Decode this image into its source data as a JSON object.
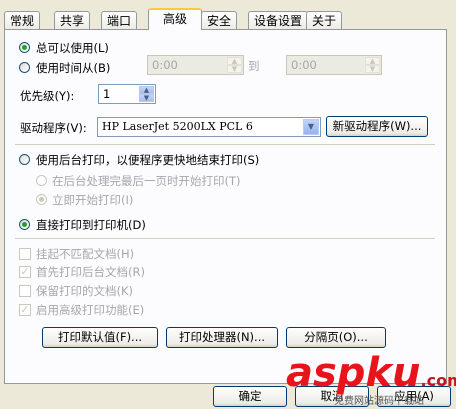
{
  "tabs": [
    "常规",
    "共享",
    "端口",
    "高级",
    "安全",
    "设备设置",
    "关于"
  ],
  "availability": {
    "always_label": "总可以使用(L)",
    "from_label": "使用时间从(B)",
    "from_time": "0:00",
    "to_label": "到",
    "to_time": "0:00"
  },
  "priority": {
    "label": "优先级(Y):",
    "value": "1"
  },
  "driver": {
    "label": "驱动程序(V):",
    "selected": "HP LaserJet 5200LX PCL 6",
    "new_driver_button": "新驱动程序(W)..."
  },
  "spool": {
    "spool_label": "使用后台打印，以便程序更快地结束打印(S)",
    "after_last_page_label": "在后台处理完最后一页时开始打印(T)",
    "immediately_label": "立即开始打印(I)",
    "direct_label": "直接打印到打印机(D)"
  },
  "options": {
    "hold_mismatched": "挂起不匹配文档(H)",
    "print_spooled_first": "首先打印后台文档(R)",
    "keep_printed": "保留打印的文档(K)",
    "enable_advanced": "启用高级打印功能(E)"
  },
  "bottom_buttons": {
    "defaults": "打印默认值(F)...",
    "processor": "打印处理器(N)...",
    "separator": "分隔页(O)..."
  },
  "dialog_buttons": {
    "ok": "确定",
    "cancel": "取消",
    "apply": "应用(A)"
  },
  "watermark": {
    "brand": "aspku",
    "tld": ".com",
    "tagline": "免费网站源码下载站"
  }
}
